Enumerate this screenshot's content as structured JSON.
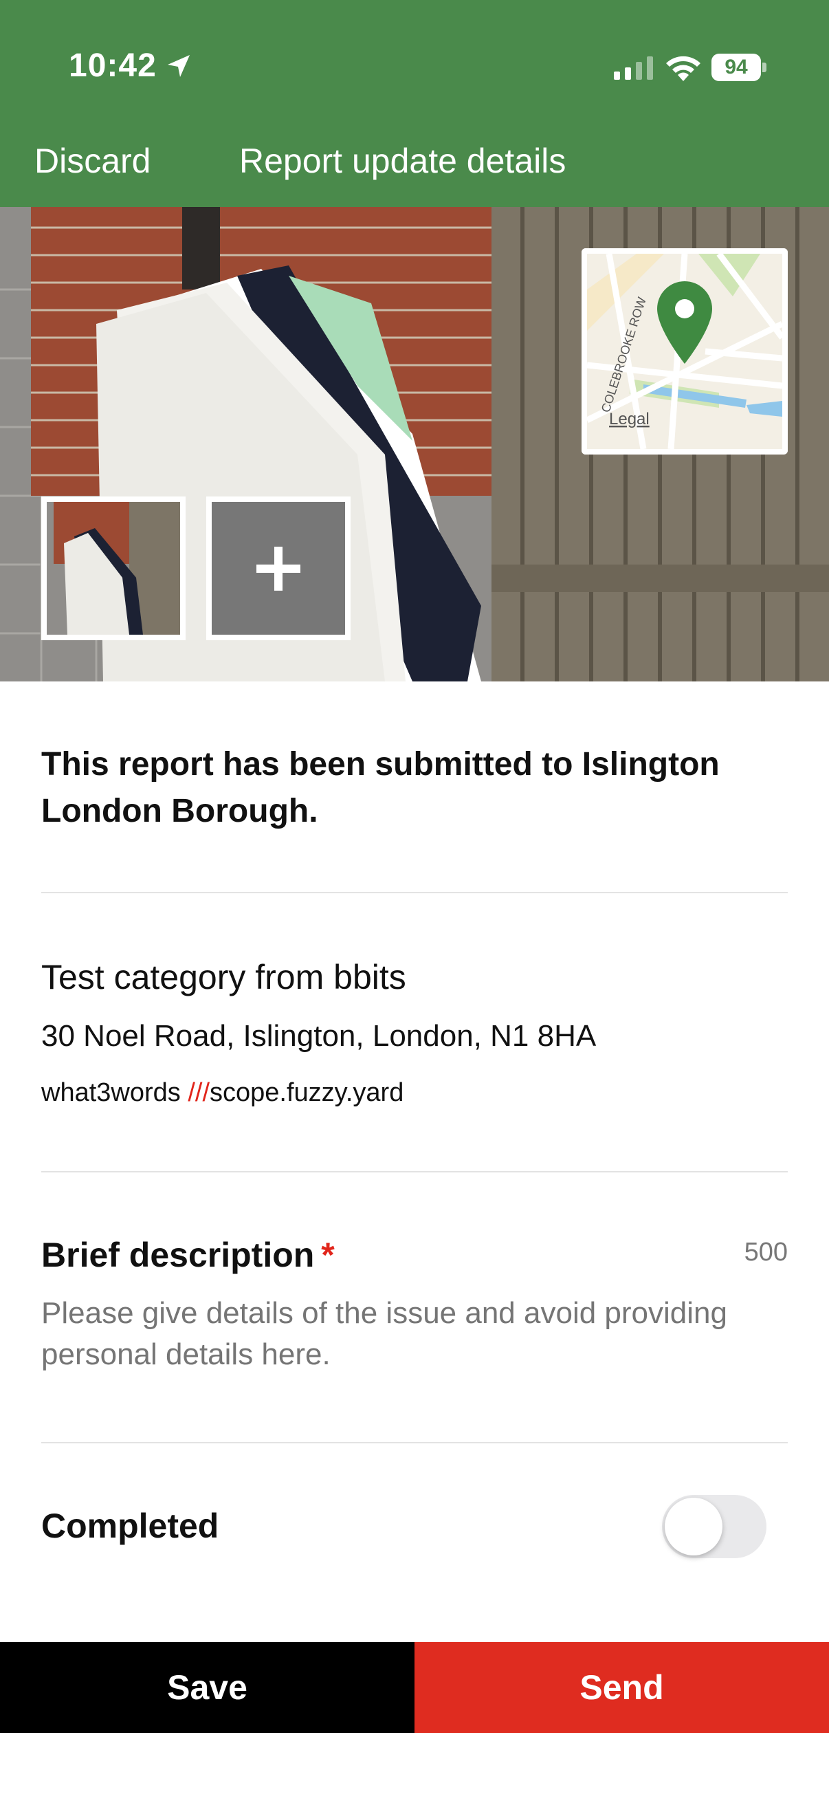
{
  "status_bar": {
    "time": "10:42",
    "battery": "94"
  },
  "nav": {
    "discard_label": "Discard",
    "title": "Report update details"
  },
  "map": {
    "street_label": "COLEBROOKE ROW",
    "legal_label": "Legal"
  },
  "report": {
    "submitted_text": "This report has been submitted to Islington London Borough.",
    "category": "Test category from bbits",
    "address": "30 Noel Road, Islington, London, N1 8HA",
    "w3w_prefix": "what3words ",
    "w3w_slashes": "///",
    "w3w_words": "scope.fuzzy.yard"
  },
  "description": {
    "label": "Brief description",
    "required_mark": "*",
    "char_count": "500",
    "placeholder": "Please give details of the issue and avoid providing personal details here."
  },
  "completed": {
    "label": "Completed",
    "value": false
  },
  "actions": {
    "save_label": "Save",
    "send_label": "Send"
  },
  "colors": {
    "header": "#4a8a4b",
    "send": "#df2c20",
    "save": "#000000",
    "required": "#e1251b"
  }
}
